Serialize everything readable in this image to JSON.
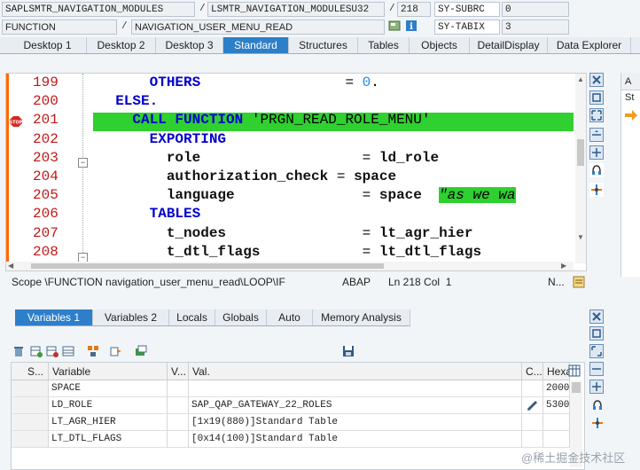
{
  "header": {
    "program": "SAPLSMTR_NAVIGATION_MODULES",
    "include": "LSMTR_NAVIGATION_MODULESU32",
    "line_no": "218",
    "sysvar1": "SY-SUBRC",
    "sysval1": "0",
    "type": "FUNCTION",
    "name": "NAVIGATION_USER_MENU_READ",
    "sysvar2": "SY-TABIX",
    "sysval2": "3",
    "sep": "/"
  },
  "tabs": [
    "Desktop 1",
    "Desktop 2",
    "Desktop 3",
    "Standard",
    "Structures",
    "Tables",
    "Objects",
    "DetailDisplay",
    "Data Explorer"
  ],
  "active_tab": "Standard",
  "code_lines": [
    {
      "no": "199",
      "html": "<span class='kw'>      OTHERS</span>                 = <span class='num'>0</span>."
    },
    {
      "no": "200",
      "html": "<span class='kw'>  ELSE.</span>"
    },
    {
      "no": "201",
      "html": "<span class='kw'>    CALL FUNCTION</span> 'PRGN_READ_ROLE_MENU'"
    },
    {
      "no": "202",
      "html": "<span class='kw'>      EXPORTING</span>"
    },
    {
      "no": "203",
      "html": "<span class='var'>        role</span>                   = <span class='var'>ld_role</span>"
    },
    {
      "no": "204",
      "html": "<span class='var'>        authorization_check</span> = <span class='var'>space</span>"
    },
    {
      "no": "205",
      "html": "<span class='var'>        language</span>               = <span class='var'>space</span>  <span class='cmt'>\"as we wa</span>"
    },
    {
      "no": "206",
      "html": "<span class='kw'>      TABLES</span>"
    },
    {
      "no": "207",
      "html": "<span class='var'>        t_nodes</span>                = <span class='var'>lt_agr_hier</span>"
    },
    {
      "no": "208",
      "html": "<span class='var'>        t_dtl_flags</span>            = <span class='var'>lt_dtl_flags</span>"
    }
  ],
  "status": {
    "scope": "Scope \\FUNCTION navigation_user_menu_read\\LOOP\\IF",
    "lang": "ABAP",
    "position": "Ln 218 Col  1",
    "mode": "N..."
  },
  "right_pane": {
    "top": "A",
    "label": "St"
  },
  "lower_tabs": [
    "Variables 1",
    "Variables 2",
    "Locals",
    "Globals",
    "Auto",
    "Memory Analysis"
  ],
  "lower_active": "Variables 1",
  "grid": {
    "headers": [
      "S...",
      "Variable",
      "V...",
      "Val.",
      "C...",
      "Hexa"
    ],
    "rows": [
      {
        "variable": "SPACE",
        "value": "",
        "hex": "2000"
      },
      {
        "variable": "LD_ROLE",
        "value": "SAP_QAP_GATEWAY_22_ROLES",
        "hex": "5300"
      },
      {
        "variable": "LT_AGR_HIER",
        "value": "[1x19(880)]Standard Table",
        "hex": ""
      },
      {
        "variable": "LT_DTL_FLAGS",
        "value": "[0x14(100)]Standard Table",
        "hex": ""
      }
    ]
  },
  "watermark": "@稀土掘金技术社区",
  "colors": {
    "accent": "#2d7fc9",
    "highlight": "#2fd02f",
    "keyword": "#0000cc",
    "line_number": "#c01818"
  }
}
